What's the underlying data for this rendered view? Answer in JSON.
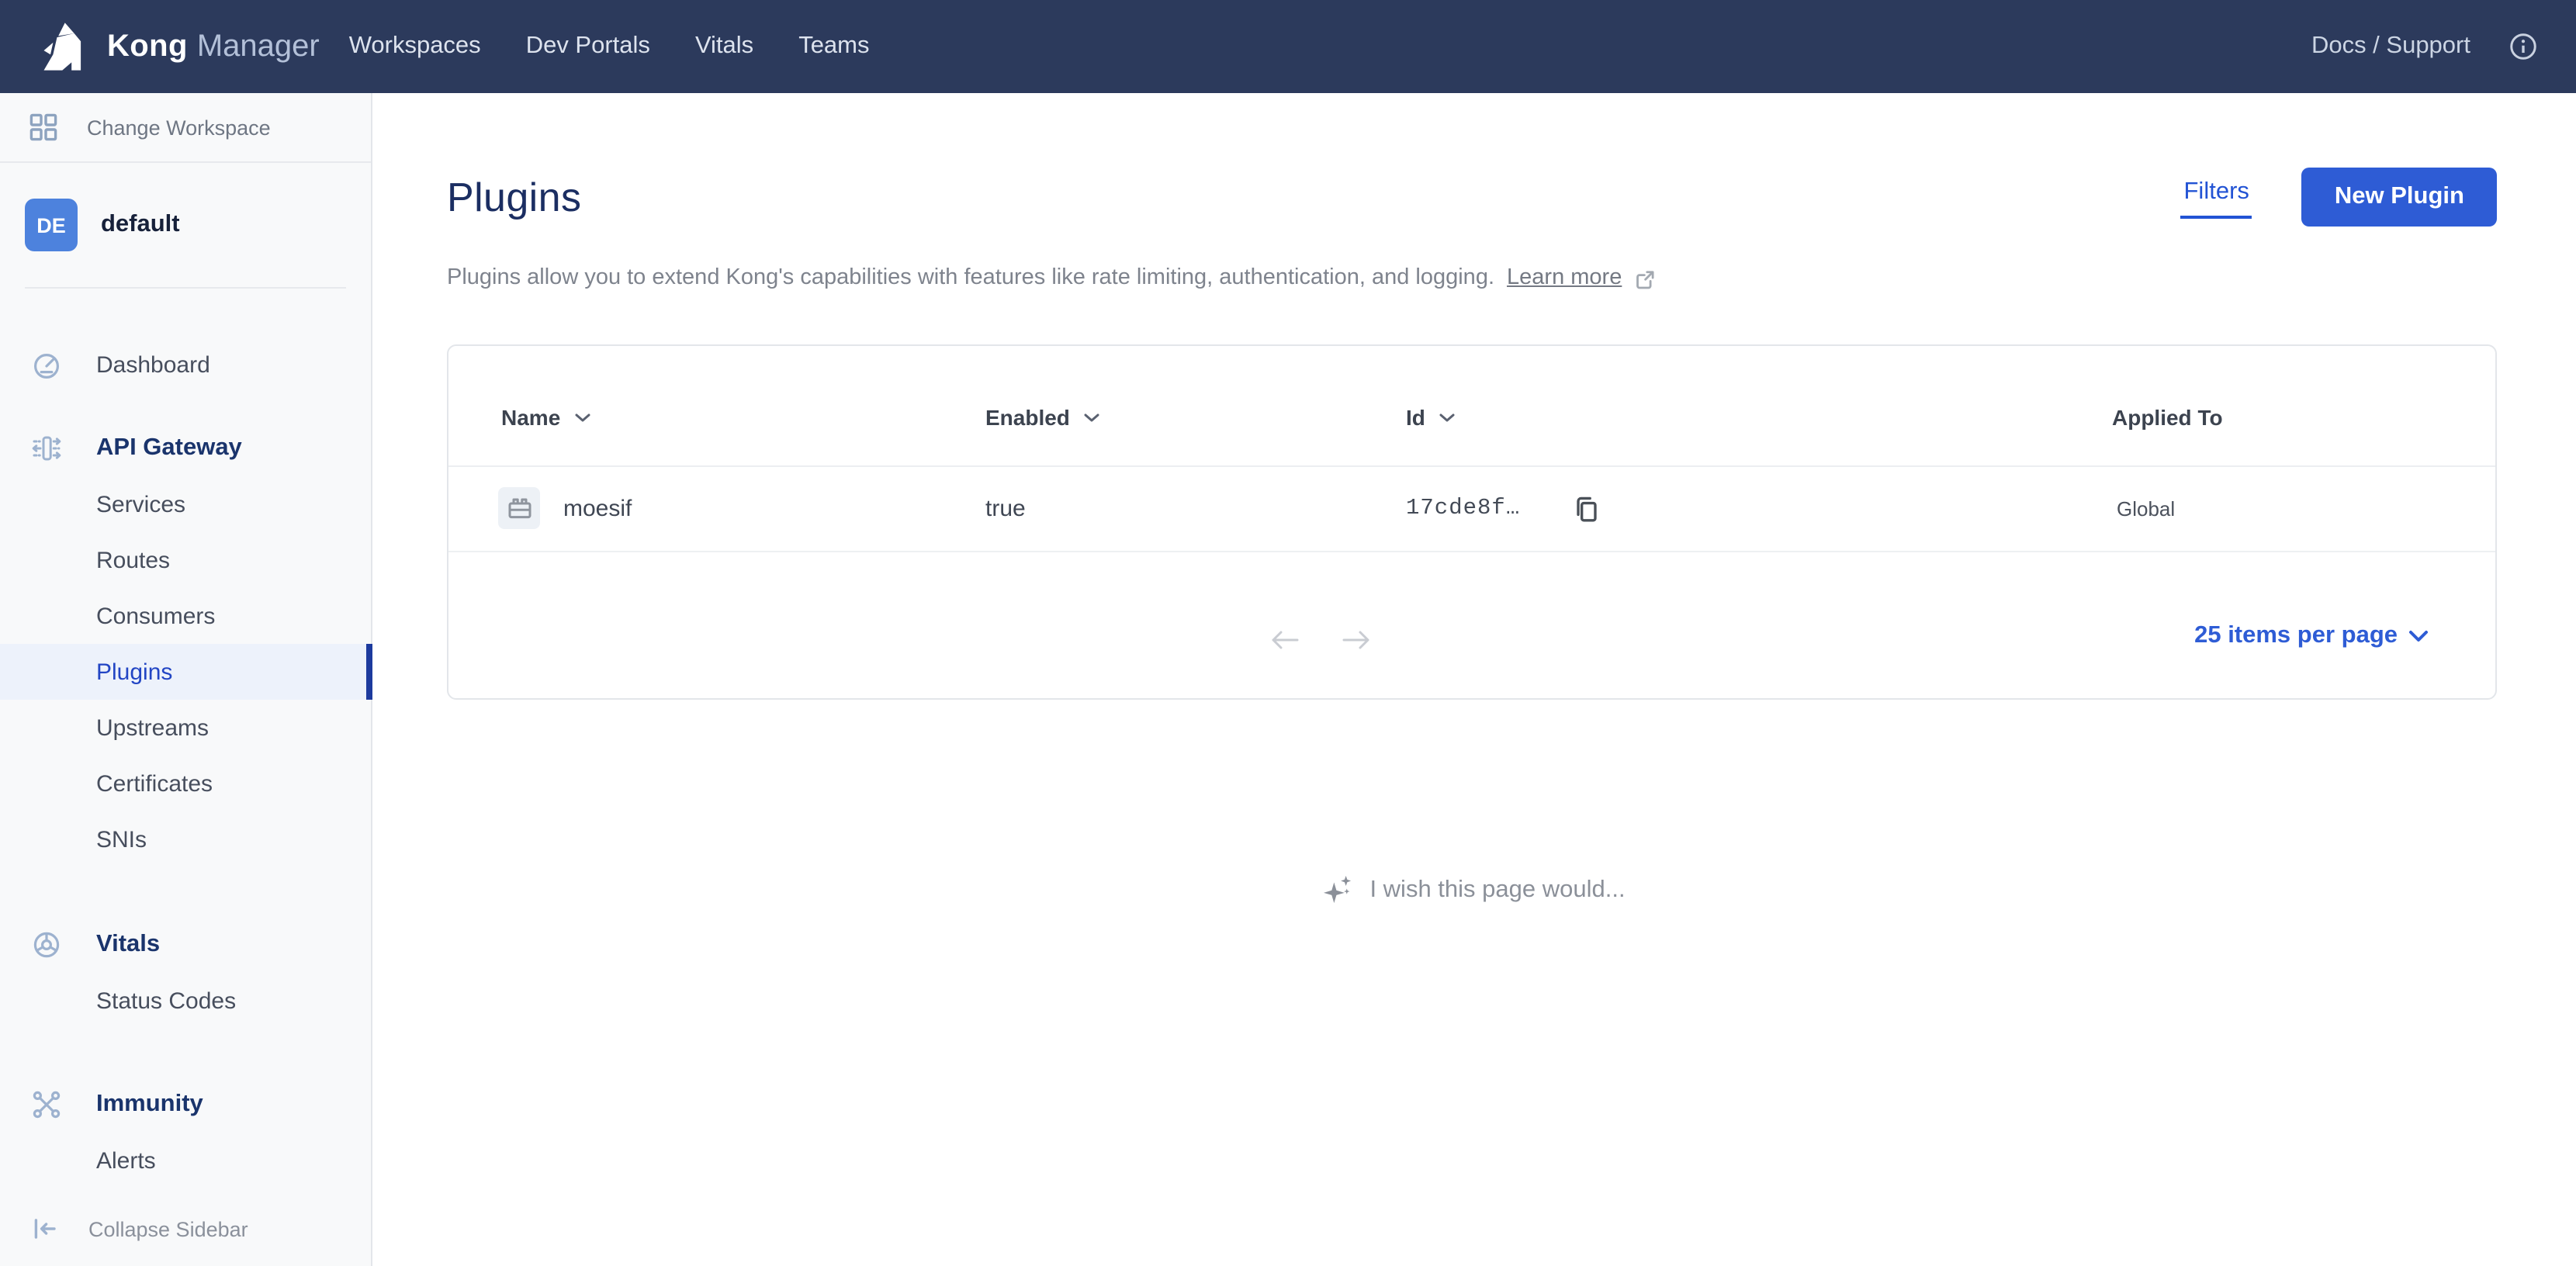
{
  "theme": {
    "nav_bg": "#2c3a5c",
    "accent": "#2e5cd5",
    "link_blue": "#2253d4",
    "selected_bg": "#edf2fb",
    "selected_text": "#2245c4",
    "selected_bar": "#1c3a9e",
    "section_text": "#1a346c",
    "title_text": "#1b2e62",
    "sidebar_bg": "#f8f9fa",
    "border": "#e3e6ea"
  },
  "nav": {
    "brand": {
      "name": "Kong",
      "suffix": "Manager"
    },
    "items": [
      {
        "label": "Workspaces"
      },
      {
        "label": "Dev Portals"
      },
      {
        "label": "Vitals"
      },
      {
        "label": "Teams"
      }
    ],
    "docs_support": "Docs / Support"
  },
  "sidebar": {
    "change_workspace": "Change Workspace",
    "workspace": {
      "initials": "DE",
      "name": "default"
    },
    "menu": [
      {
        "label": "Dashboard"
      },
      {
        "label": "API Gateway"
      },
      {
        "label": "Services"
      },
      {
        "label": "Routes"
      },
      {
        "label": "Consumers"
      },
      {
        "label": "Plugins",
        "active": true
      },
      {
        "label": "Upstreams"
      },
      {
        "label": "Certificates"
      },
      {
        "label": "SNIs"
      },
      {
        "label": "Vitals"
      },
      {
        "label": "Status Codes"
      },
      {
        "label": "Immunity"
      },
      {
        "label": "Alerts"
      }
    ],
    "collapse_label": "Collapse Sidebar"
  },
  "page": {
    "title": "Plugins",
    "filters_label": "Filters",
    "new_plugin_label": "New Plugin",
    "description": "Plugins allow you to extend Kong's capabilities with features like rate limiting, authentication, and logging.",
    "learn_more": "Learn more"
  },
  "table": {
    "columns": [
      {
        "label": "Name",
        "sortable": true
      },
      {
        "label": "Enabled",
        "sortable": true
      },
      {
        "label": "Id",
        "sortable": true
      },
      {
        "label": "Applied To",
        "sortable": false
      }
    ],
    "rows": [
      {
        "name": "moesif",
        "enabled": "true",
        "id": "17cde8f…",
        "applied_to": "Global"
      }
    ]
  },
  "pagination": {
    "items_per_page": "25 items per page"
  },
  "wish": {
    "text": "I wish this page would..."
  },
  "icons": {
    "workspace_grid": "grid-2x2",
    "dashboard": "gauge",
    "api_gateway": "gateway-arrows",
    "vitals": "wheel",
    "immunity": "network-x",
    "collapse": "collapse-left-arrow",
    "info": "info-circle",
    "sort": "chevron-down",
    "plugin": "brick",
    "copy": "copy-sheets",
    "external_link": "box-arrow",
    "sparkles": "sparkles",
    "prev": "arrow-left",
    "next": "arrow-right"
  }
}
